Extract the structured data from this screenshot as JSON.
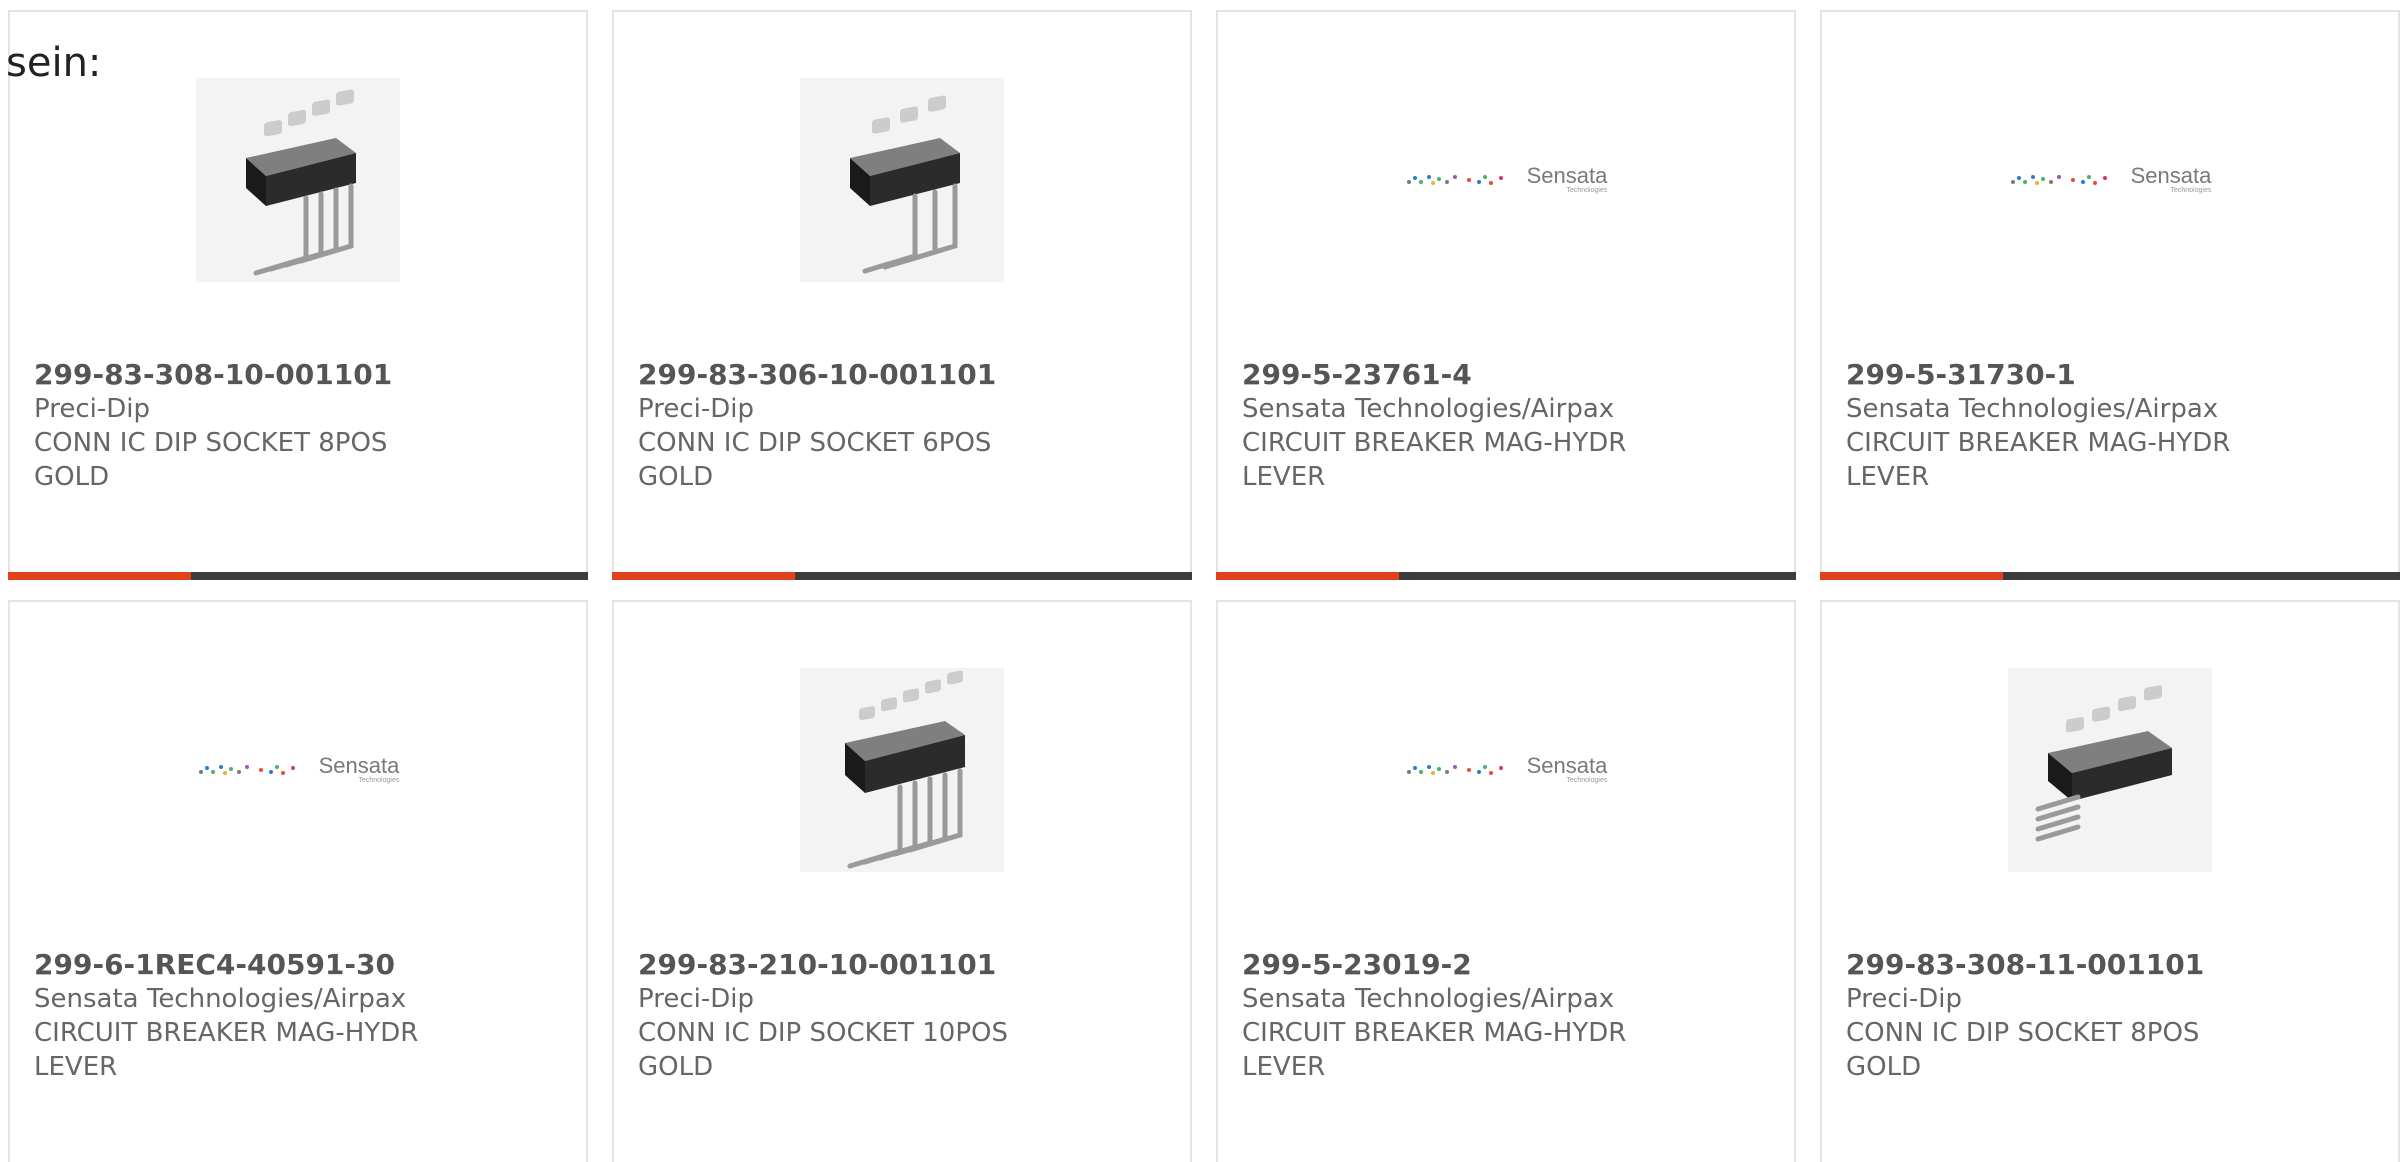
{
  "overlay_text": "sein:",
  "colors": {
    "accent": "#e2411d",
    "bar": "#3d3d3d",
    "border": "#e3e3e3",
    "text": "#666666"
  },
  "products": [
    {
      "part_number": "299-83-308-10-001101",
      "manufacturer": "Preci-Dip",
      "description_line1": "CONN IC DIP SOCKET 8POS",
      "description_line2": "GOLD",
      "image": "ic-socket-image"
    },
    {
      "part_number": "299-83-306-10-001101",
      "manufacturer": "Preci-Dip",
      "description_line1": "CONN IC DIP SOCKET 6POS",
      "description_line2": "GOLD",
      "image": "ic-socket-image"
    },
    {
      "part_number": "299-5-23761-4",
      "manufacturer": "Sensata Technologies/Airpax",
      "description_line1": "CIRCUIT BREAKER MAG-HYDR",
      "description_line2": "LEVER",
      "image": "sensata-logo",
      "logo_text": "Sensata",
      "logo_sub": "Technologies"
    },
    {
      "part_number": "299-5-31730-1",
      "manufacturer": "Sensata Technologies/Airpax",
      "description_line1": "CIRCUIT BREAKER MAG-HYDR",
      "description_line2": "LEVER",
      "image": "sensata-logo",
      "logo_text": "Sensata",
      "logo_sub": "Technologies"
    },
    {
      "part_number": "299-6-1REC4-40591-30",
      "manufacturer": "Sensata Technologies/Airpax",
      "description_line1": "CIRCUIT BREAKER MAG-HYDR",
      "description_line2": "LEVER",
      "image": "sensata-logo",
      "logo_text": "Sensata",
      "logo_sub": "Technologies"
    },
    {
      "part_number": "299-83-210-10-001101",
      "manufacturer": "Preci-Dip",
      "description_line1": "CONN IC DIP SOCKET 10POS",
      "description_line2": "GOLD",
      "image": "ic-socket-image"
    },
    {
      "part_number": "299-5-23019-2",
      "manufacturer": "Sensata Technologies/Airpax",
      "description_line1": "CIRCUIT BREAKER MAG-HYDR",
      "description_line2": "LEVER",
      "image": "sensata-logo",
      "logo_text": "Sensata",
      "logo_sub": "Technologies"
    },
    {
      "part_number": "299-83-308-11-001101",
      "manufacturer": "Preci-Dip",
      "description_line1": "CONN IC DIP SOCKET 8POS",
      "description_line2": "GOLD",
      "image": "ic-socket-image"
    }
  ]
}
